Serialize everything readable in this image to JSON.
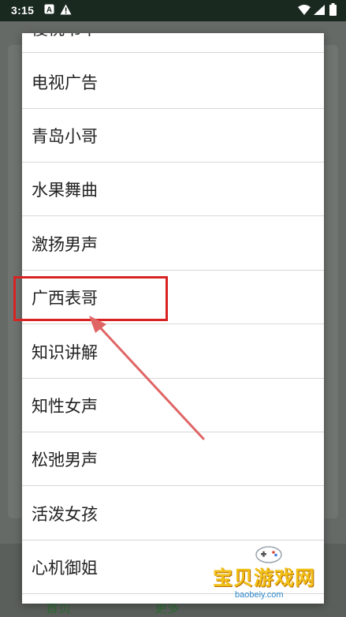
{
  "status_bar": {
    "time": "3:15",
    "icons": [
      "notification-a-icon",
      "warning-icon",
      "wifi-icon",
      "signal-icon",
      "battery-icon"
    ]
  },
  "dialog": {
    "items": [
      {
        "label": "傻桃书中"
      },
      {
        "label": "电视广告"
      },
      {
        "label": "青岛小哥"
      },
      {
        "label": "水果舞曲"
      },
      {
        "label": "激扬男声"
      },
      {
        "label": "广西表哥"
      },
      {
        "label": "知识讲解"
      },
      {
        "label": "知性女声"
      },
      {
        "label": "松弛男声"
      },
      {
        "label": "活泼女孩"
      },
      {
        "label": "心机御姐"
      }
    ],
    "highlighted_item": "广西表哥"
  },
  "background": {
    "tabs": [
      "首页",
      "更多"
    ]
  },
  "watermark": {
    "title": "宝贝游戏网",
    "url": "baobeiy.com"
  },
  "colors": {
    "highlight": "#d92323",
    "status_bar": "#19291f",
    "watermark_title": "#f2c118",
    "watermark_url": "#2f87c8"
  }
}
